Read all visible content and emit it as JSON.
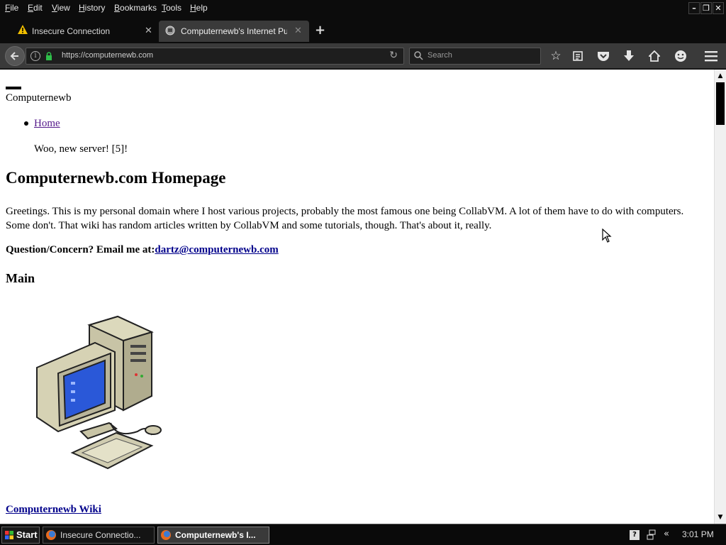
{
  "menu": {
    "items": [
      "File",
      "Edit",
      "View",
      "History",
      "Bookmarks",
      "Tools",
      "Help"
    ]
  },
  "window_controls": {
    "minimize": "–",
    "restore": "❐",
    "close": "✕"
  },
  "tabs": [
    {
      "label": "Insecure Connection",
      "icon": "warning-icon",
      "close": "✕",
      "active": false
    },
    {
      "label": "Computernewb's Internet Pu...",
      "icon": "site-icon",
      "close": "✕",
      "active": true
    }
  ],
  "new_tab": "+",
  "navbar": {
    "url": "https://computernewb.com",
    "search_placeholder": "Search",
    "lock_color": "#2fbf4a"
  },
  "page": {
    "site_name": "Computernewb",
    "nav_home": "Home",
    "announcement": "Woo, new server! [5]!",
    "title": "Computernewb.com Homepage",
    "intro": "Greetings. This is my personal domain where I host various projects, probably the most famous one being CollabVM. A lot of them have to do with computers. Some don't. That wiki has random articles written by CollabVM and some tutorials, though. That's about it, really.",
    "contact_label": "Question/Concern? Email me at:",
    "contact_email": "dartz@computernewb.com",
    "main_heading": "Main",
    "wiki_link": "Computernewb Wiki"
  },
  "taskbar": {
    "start_label": "Start",
    "tasks": [
      {
        "label": "Insecure Connectio...",
        "active": false
      },
      {
        "label": "Computernewb's I...",
        "active": true
      }
    ],
    "tray_expand": "«",
    "clock": "3:01 PM"
  }
}
